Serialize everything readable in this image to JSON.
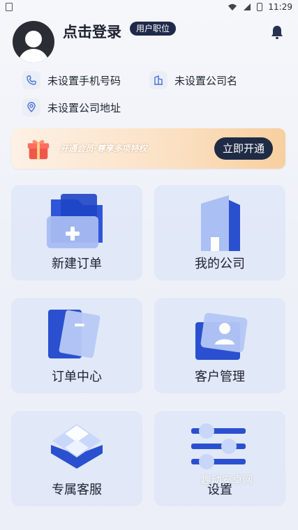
{
  "status_bar": {
    "time": "11:29",
    "left_icon": "notification-icon",
    "wifi_icon": "wifi-icon",
    "signal_icon": "signal-icon",
    "battery_icon": "battery-icon"
  },
  "header": {
    "login_text": "点击登录",
    "role_badge": "用户职位",
    "avatar_icon": "avatar-placeholder-icon",
    "bell_icon": "bell-icon"
  },
  "info": {
    "phone_text": "未设置手机号码",
    "company_text": "未设置公司名",
    "address_text": "未设置公司地址",
    "phone_icon": "phone-icon",
    "company_icon": "building-icon",
    "address_icon": "location-icon"
  },
  "promo": {
    "text": "开通会员·尊享多项特权",
    "button_label": "立即开通",
    "gift_icon": "gift-icon"
  },
  "menu": {
    "items": [
      {
        "label": "新建订单",
        "icon": "new-order-icon"
      },
      {
        "label": "我的公司",
        "icon": "company-icon"
      },
      {
        "label": "订单中心",
        "icon": "order-center-icon"
      },
      {
        "label": "客户管理",
        "icon": "customer-management-icon"
      },
      {
        "label": "专属客服",
        "icon": "customer-service-icon"
      },
      {
        "label": "设置",
        "icon": "settings-icon"
      }
    ]
  },
  "watermark": "趣动安卓网",
  "colors": {
    "accent": "#1f2b45",
    "brand_blue": "#2f56d9"
  }
}
